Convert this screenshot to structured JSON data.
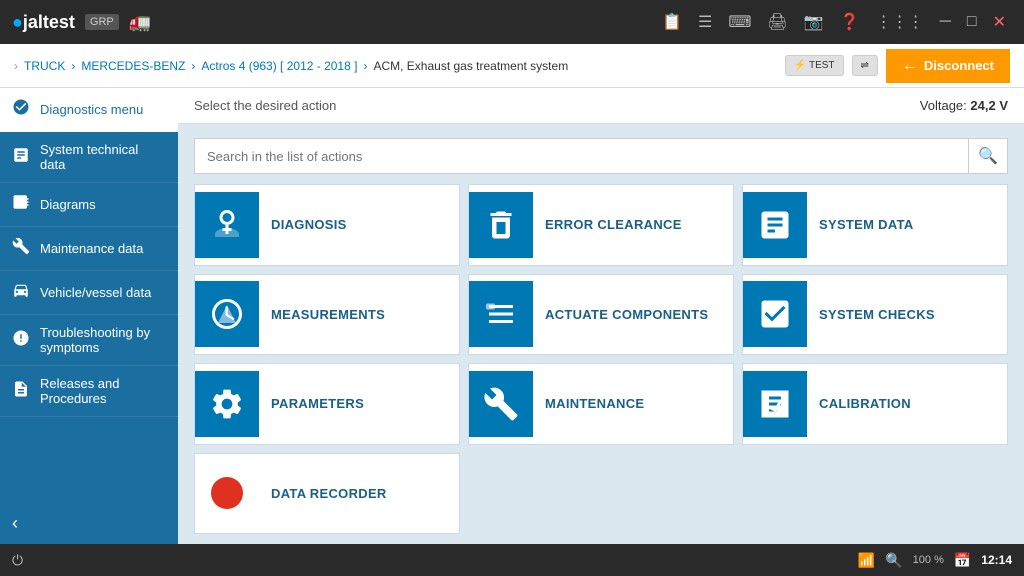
{
  "topbar": {
    "logo": "jaltest",
    "logo_dot": ".",
    "group": "GRP",
    "icons": [
      "clipboard-icon",
      "list-icon",
      "keyboard-icon",
      "printer-icon",
      "camera-icon",
      "question-icon",
      "grid-icon",
      "minimize-icon",
      "maximize-icon",
      "close-icon"
    ]
  },
  "breadcrumb": {
    "items": [
      "TRUCK",
      "MERCEDES-BENZ",
      "Actros 4 (963) [ 2012 - 2018 ]",
      "ACM, Exhaust gas treatment system"
    ],
    "test_label": "TEST",
    "disconnect_label": "Disconnect"
  },
  "sidebar": {
    "items": [
      {
        "id": "diagnostics-menu",
        "label": "Diagnostics menu",
        "icon": "🔧"
      },
      {
        "id": "system-technical-data",
        "label": "System technical data",
        "icon": "📊"
      },
      {
        "id": "diagrams",
        "label": "Diagrams",
        "icon": "📐"
      },
      {
        "id": "maintenance-data",
        "label": "Maintenance data",
        "icon": "🔩"
      },
      {
        "id": "vehicle-vessel-data",
        "label": "Vehicle/vessel data",
        "icon": "🚛"
      },
      {
        "id": "troubleshooting",
        "label": "Troubleshooting by symptoms",
        "icon": "⚙"
      },
      {
        "id": "releases",
        "label": "Releases and Procedures",
        "icon": "📋"
      }
    ],
    "collapse_icon": "‹"
  },
  "content": {
    "header_title": "Select the desired action",
    "voltage_label": "Voltage:",
    "voltage_value": "24,2 V",
    "search_placeholder": "Search in the list of actions"
  },
  "actions": [
    {
      "id": "diagnosis",
      "label": "DIAGNOSIS",
      "icon_type": "diagnosis"
    },
    {
      "id": "error-clearance",
      "label": "ERROR CLEARANCE",
      "icon_type": "error-clearance"
    },
    {
      "id": "system-data",
      "label": "SYSTEM DATA",
      "icon_type": "system-data"
    },
    {
      "id": "measurements",
      "label": "MEASUREMENTS",
      "icon_type": "measurements"
    },
    {
      "id": "actuate-components",
      "label": "ACTUATE COMPONENTS",
      "icon_type": "actuate"
    },
    {
      "id": "system-checks",
      "label": "SYSTEM CHECKS",
      "icon_type": "system-checks"
    },
    {
      "id": "parameters",
      "label": "PARAMETERS",
      "icon_type": "parameters"
    },
    {
      "id": "maintenance",
      "label": "MAINTENANCE",
      "icon_type": "maintenance"
    },
    {
      "id": "calibration",
      "label": "CALIBRATION",
      "icon_type": "calibration"
    },
    {
      "id": "data-recorder",
      "label": "DATA RECORDER",
      "icon_type": "data-recorder"
    }
  ],
  "statusbar": {
    "wifi_icon": "wifi-icon",
    "zoom_icon": "zoom-icon",
    "zoom_value": "100 %",
    "calendar_icon": "calendar-icon",
    "time": "12:14"
  }
}
